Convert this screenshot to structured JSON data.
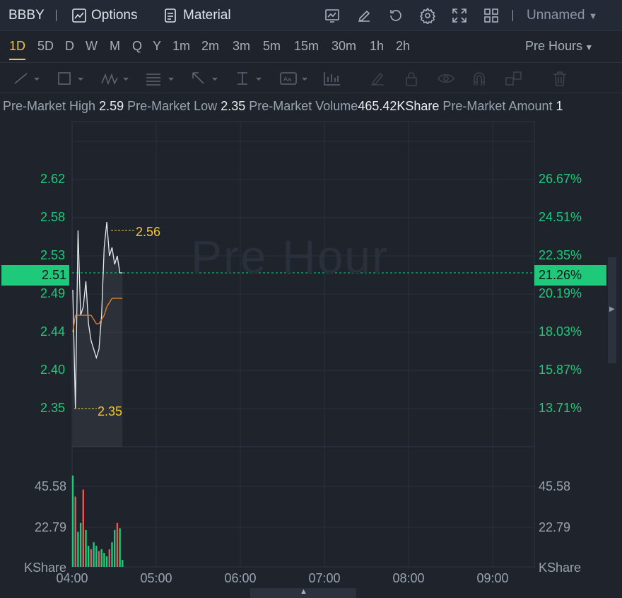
{
  "header": {
    "ticker": "BBBY",
    "options_label": "Options",
    "material_label": "Material",
    "layout_name": "Unnamed"
  },
  "periods": [
    "1D",
    "5D",
    "D",
    "W",
    "M",
    "Q",
    "Y",
    "1m",
    "2m",
    "3m",
    "5m",
    "15m",
    "30m",
    "1h",
    "2h"
  ],
  "active_period": "1D",
  "session_select": "Pre Hours",
  "info": {
    "high_label": "Pre-Market High",
    "high_value": "2.59",
    "low_label": "Pre-Market Low",
    "low_value": "2.35",
    "volume_label": "Pre-Market Volume",
    "volume_value": "465.42KShare",
    "amount_label": "Pre-Market Amount",
    "amount_value": "1"
  },
  "watermark": "Pre Hour",
  "price_axis": [
    "2.62",
    "2.58",
    "2.53",
    "2.49",
    "2.44",
    "2.40",
    "2.35"
  ],
  "pct_axis": [
    "26.67%",
    "24.51%",
    "22.35%",
    "20.19%",
    "18.03%",
    "15.87%",
    "13.71%"
  ],
  "current_price": "2.51",
  "current_pct": "21.26%",
  "high_marker": "2.56",
  "low_marker": "2.35",
  "volume_axis": [
    "45.58",
    "22.79"
  ],
  "volume_unit": "KShare",
  "time_axis": [
    "04:00",
    "05:00",
    "06:00",
    "07:00",
    "08:00",
    "09:00"
  ],
  "colors": {
    "up": "#1fc97a",
    "down": "#e85656",
    "accent": "#f5c431",
    "avg_line": "#e8892a"
  },
  "chart_data": {
    "type": "line",
    "x": [
      "04:00",
      "04:02",
      "04:04",
      "04:06",
      "04:08",
      "04:10",
      "04:12",
      "04:14",
      "04:16",
      "04:18",
      "04:20",
      "04:22",
      "04:24",
      "04:26",
      "04:28",
      "04:30",
      "04:32",
      "04:34",
      "04:36",
      "04:38"
    ],
    "series": [
      {
        "values": [
          2.49,
          2.35,
          2.56,
          2.46,
          2.47,
          2.5,
          2.45,
          2.43,
          2.42,
          2.41,
          2.42,
          2.46,
          2.54,
          2.57,
          2.53,
          2.54,
          2.52,
          2.53,
          2.51,
          2.51
        ]
      }
    ],
    "avg_line": [
      2.44,
      2.46,
      2.46,
      2.46,
      2.46,
      2.46,
      2.46,
      2.46,
      2.455,
      2.45,
      2.45,
      2.455,
      2.46,
      2.47,
      2.475,
      2.48,
      2.48,
      2.48,
      2.48,
      2.48
    ],
    "volume": [
      52,
      40,
      20,
      25,
      44,
      21,
      12,
      10,
      14,
      12,
      9,
      10,
      8,
      6,
      10,
      14,
      21,
      25,
      22,
      4
    ],
    "volume_up": [
      true,
      false,
      true,
      true,
      false,
      true,
      true,
      false,
      true,
      true,
      false,
      true,
      true,
      true,
      false,
      true,
      true,
      false,
      true,
      true
    ],
    "ylim": [
      2.33,
      2.665
    ],
    "vol_ylim": [
      0,
      68.37
    ]
  }
}
